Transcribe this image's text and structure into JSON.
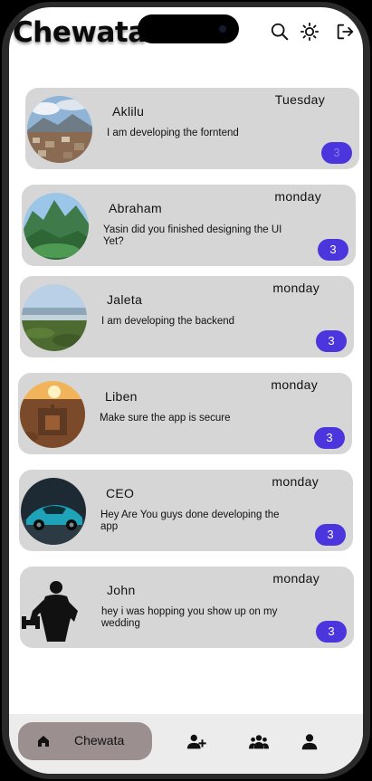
{
  "header": {
    "title": "Chewata"
  },
  "chats": [
    {
      "name": "Aklilu",
      "day": "Tuesday",
      "message": "I am developing the forntend",
      "unread": "3",
      "avatar": "mountain-village-photo"
    },
    {
      "name": "Abraham",
      "day": "monday",
      "message": "Yasin did you finished designing the UI Yet?",
      "unread": "3",
      "avatar": "green-mountains-photo"
    },
    {
      "name": "Jaleta",
      "day": "monday",
      "message": "I am developing the backend",
      "unread": "3",
      "avatar": "lake-landscape-photo"
    },
    {
      "name": "Liben",
      "day": "monday",
      "message": "Make sure the app is secure",
      "unread": "3",
      "avatar": "rock-church-photo"
    },
    {
      "name": "CEO",
      "day": "monday",
      "message": "Hey Are You guys done developing the app",
      "unread": "3",
      "avatar": "sports-car-photo"
    },
    {
      "name": "John",
      "day": "monday",
      "message": "hey i was hopping you show up on my wedding",
      "unread": "3",
      "avatar": "bodybuilder-silhouette"
    }
  ],
  "bottom_nav": {
    "home_label": "Chewata"
  },
  "icons": {
    "header": [
      "search-icon",
      "theme-toggle-icon",
      "logout-icon"
    ],
    "nav": [
      "home-icon",
      "add-person-icon",
      "group-icon",
      "profile-icon"
    ]
  },
  "colors": {
    "badge": "#4b35dc",
    "card": "#d6d6d6",
    "home_pill": "#9b8f8f"
  }
}
